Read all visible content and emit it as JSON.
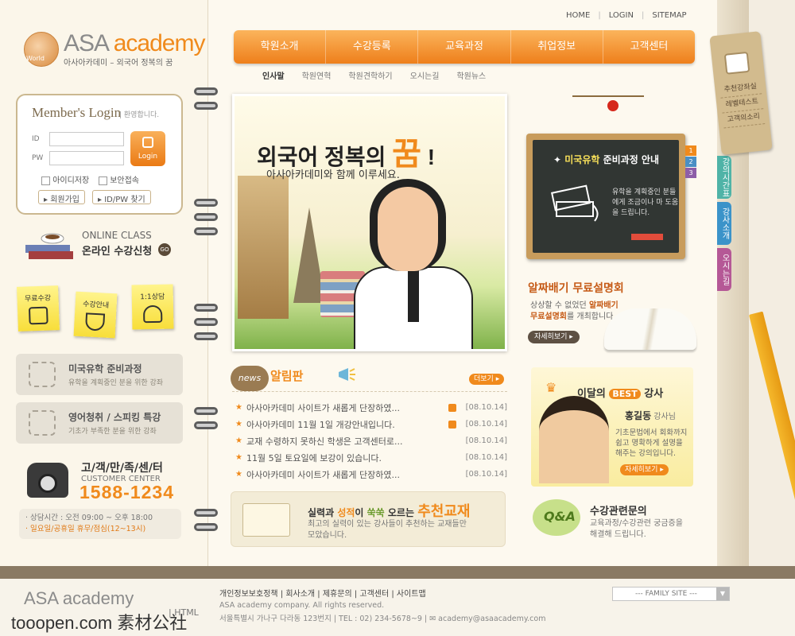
{
  "top_links": [
    "HOME",
    "LOGIN",
    "SITEMAP"
  ],
  "logo": {
    "prefix": "ASA ",
    "suffix": "academy",
    "tagline": "아사아카데미 – 외국어 정복의 꿈",
    "badge": "World"
  },
  "nav": [
    "학원소개",
    "수강등록",
    "교육과정",
    "취업정보",
    "고객센터"
  ],
  "subnav": [
    "인사말",
    "학원연혁",
    "학원견학하기",
    "오시는길",
    "학원뉴스"
  ],
  "login": {
    "title": "Member's Login",
    "greeting": "| 환영합니다.",
    "id_label": "ID",
    "pw_label": "PW",
    "button": "Login",
    "save_id": "아이디저장",
    "secure": "보안접속",
    "join": "회원가입",
    "find": "ID/PW 찾기"
  },
  "online_class": {
    "title": "ONLINE CLASS",
    "subtitle": "온라인 수강신청",
    "go": "GO"
  },
  "sticky_notes": [
    "무료수강",
    "수강안내",
    "1:1상담"
  ],
  "cards": [
    {
      "title": "미국유학 준비과정",
      "desc": "유학을 계획중인 분을 위한 강좌"
    },
    {
      "title": "영어청취 / 스피킹 특강",
      "desc": "기초가 부족한 분을 위한 강좌"
    }
  ],
  "customer_center": {
    "title": "고/객/만/족/센/터",
    "subtitle": "CUSTOMER CENTER",
    "phone": "1588-1234",
    "hours": "· 상담시간 : 오전 09:00 ~ 오후 18:00",
    "holiday": "· 일요일/공휴일 휴무/점심(12~13시)"
  },
  "hero": {
    "title_prefix": "외국어 정복의 ",
    "title_big": "꿈",
    "title_suffix": " !",
    "subtitle": "아사아카데미와 함께 이루세요."
  },
  "board": {
    "title_y": "미국유학",
    "title_w": " 준비과정 안내",
    "text": "유학을 계획중인 분들에게 조금이나 마 도움을 드립니다.",
    "tabs": [
      "1",
      "2",
      "3"
    ]
  },
  "free_seminar": {
    "title": "알짜배기 무료설명회",
    "text1": "상상할 수 없었던 ",
    "text1_hl": "알짜배기",
    "text2_hl": "무료설명회",
    "text2": "를 개최합니다.",
    "more": "자세히보기 ▸"
  },
  "side_tabs": [
    {
      "label": "강의시간표",
      "color": "#4fb3a7"
    },
    {
      "label": "강사소개",
      "color": "#3b93c9"
    },
    {
      "label": "오시는길",
      "color": "#b55896"
    }
  ],
  "tag_items": [
    "추천강좌실",
    "레벨테스트",
    "고객의소리"
  ],
  "notice": {
    "badge": "news",
    "title": "알림판",
    "more": "더보기 ▸",
    "items": [
      {
        "text": "아사아카데미 사이트가 새롭게 단장하였...",
        "date": "[08.10.14]",
        "new": true
      },
      {
        "text": "아사아카데미 11월 1일 개강안내입니다.",
        "date": "[08.10.14]",
        "new": true
      },
      {
        "text": "교재 수령하지 못하신 학생은 고객센터로...",
        "date": "[08.10.14]",
        "new": false
      },
      {
        "text": "11월 5일 토요일에 보강이 있습니다.",
        "date": "[08.10.14]",
        "new": false
      },
      {
        "text": "아사아카데미 사이트가 새롭게 단장하였...",
        "date": "[08.10.14]",
        "new": false
      }
    ]
  },
  "recommend": {
    "t_a": "실력",
    "t_b": "과 ",
    "t_c": "성적",
    "t_d": "이 ",
    "t_e": "쑥쑥",
    "t_f": " 오르는 ",
    "t_big": "추천교재",
    "desc1": "최고의 실력이 있는 강사들이 추천하는 교재들만",
    "desc2": "모았습니다."
  },
  "best_teacher": {
    "pre": "이달의 ",
    "best": "BEST",
    "post": " 강사",
    "name": "홍길동",
    "name_suffix": " 강사님",
    "desc": "기초문법에서 회화까지 쉽고 명확하게 설명을 해주는 강의입니다.",
    "more": "자세히보기 ▸"
  },
  "qa": {
    "title": "수강관련문의",
    "desc1": "교육과정/수강관련 궁금증을",
    "desc2": "해결해 드립니다."
  },
  "footer": {
    "logo": "ASA academy",
    "html": "| HTML",
    "links": "개인정보보호정책 | 회사소개 | 제휴문의 | 고객센터 | 사이트맵",
    "copyright": "ASA academy company. All rights reserved.",
    "address": "서울특별시 가나구 다라동 123번지  |  TEL : 02) 234-5678~9  |  ✉ academy@asaacademy.com",
    "family_site": "--- FAMILY SITE ---",
    "watermark": "tooopen.com 素材公社"
  }
}
